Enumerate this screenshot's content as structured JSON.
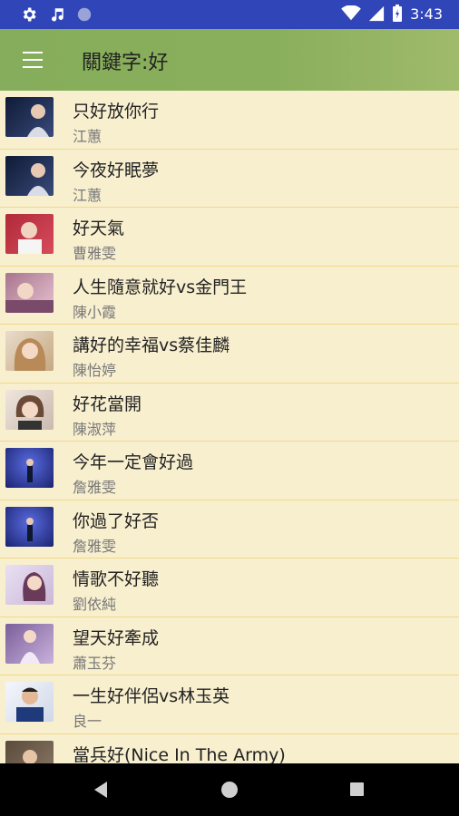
{
  "status_bar": {
    "time": "3:43",
    "icons_left": [
      "gear-icon",
      "music-note-icon",
      "circle-icon"
    ],
    "icons_right": [
      "wifi-icon",
      "signal-icon",
      "battery-icon"
    ]
  },
  "app_bar": {
    "menu_icon": "hamburger-menu-icon",
    "title": "關鍵字:好"
  },
  "songs": [
    {
      "title": "只好放你行",
      "artist": "江蕙",
      "thumb_color": "#1d2a4a"
    },
    {
      "title": "今夜好眠夢",
      "artist": "江蕙",
      "thumb_color": "#1d2a4a"
    },
    {
      "title": "好天氣",
      "artist": "曹雅雯",
      "thumb_color": "#b02a3a"
    },
    {
      "title": "人生隨意就好vs金門王",
      "artist": "陳小霞",
      "thumb_color": "#a8758e"
    },
    {
      "title": "講好的幸福vs蔡佳麟",
      "artist": "陳怡婷",
      "thumb_color": "#c6a882"
    },
    {
      "title": "好花當開",
      "artist": "陳淑萍",
      "thumb_color": "#8a6d5a"
    },
    {
      "title": "今年一定會好過",
      "artist": "詹雅雯",
      "thumb_color": "#2b3a9a"
    },
    {
      "title": "你過了好否",
      "artist": "詹雅雯",
      "thumb_color": "#2b3a9a"
    },
    {
      "title": "情歌不好聽",
      "artist": "劉依純",
      "thumb_color": "#c9b7d8"
    },
    {
      "title": "望天好牽成",
      "artist": "蕭玉芬",
      "thumb_color": "#9a7fb0"
    },
    {
      "title": "一生好伴侶vs林玉英",
      "artist": "良一",
      "thumb_color": "#cfd8e8"
    },
    {
      "title": "當兵好(Nice In The Army)",
      "artist": "",
      "thumb_color": "#6a5a4a"
    }
  ],
  "nav_bar": {
    "back_icon": "back-triangle-icon",
    "home_icon": "home-circle-icon",
    "recent_icon": "recent-apps-square-icon"
  }
}
